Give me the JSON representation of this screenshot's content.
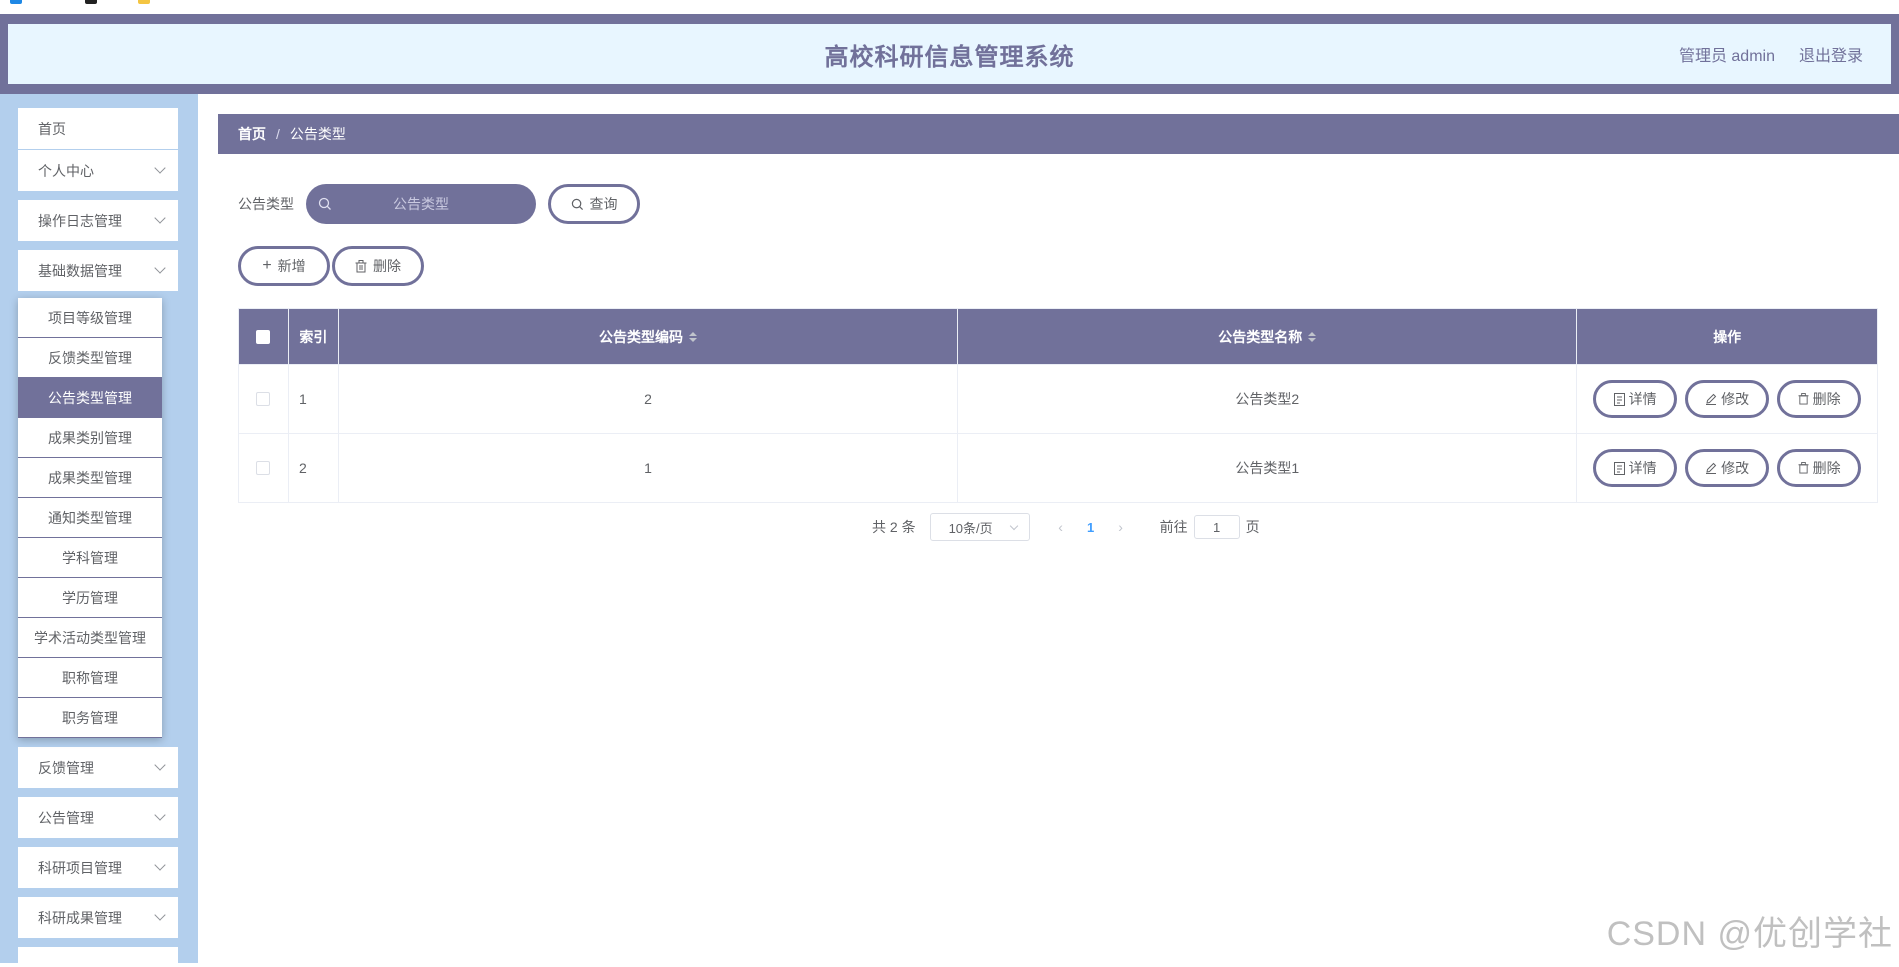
{
  "header": {
    "title": "高校科研信息管理系统",
    "user": "管理员 admin",
    "logout": "退出登录"
  },
  "sidebar": {
    "items": [
      {
        "label": "首页",
        "has_arrow": false
      },
      {
        "label": "个人中心",
        "has_arrow": true
      },
      {
        "label": "操作日志管理",
        "has_arrow": true
      },
      {
        "label": "基础数据管理",
        "has_arrow": true
      },
      {
        "label": "反馈管理",
        "has_arrow": true
      },
      {
        "label": "公告管理",
        "has_arrow": true
      },
      {
        "label": "科研项目管理",
        "has_arrow": true
      },
      {
        "label": "科研成果管理",
        "has_arrow": true
      }
    ],
    "submenu": [
      "项目等级管理",
      "反馈类型管理",
      "公告类型管理",
      "成果类别管理",
      "成果类型管理",
      "通知类型管理",
      "学科管理",
      "学历管理",
      "学术活动类型管理",
      "职称管理",
      "职务管理"
    ],
    "active_submenu": "公告类型管理"
  },
  "breadcrumb": {
    "home": "首页",
    "separator": "/",
    "current": "公告类型"
  },
  "search": {
    "label": "公告类型",
    "placeholder": "公告类型",
    "button": "查询"
  },
  "actions": {
    "add": "新增",
    "delete": "删除"
  },
  "table": {
    "headers": {
      "index": "索引",
      "code": "公告类型编码",
      "name": "公告类型名称",
      "ops": "操作"
    },
    "rows": [
      {
        "index": "1",
        "code": "2",
        "name": "公告类型2"
      },
      {
        "index": "2",
        "code": "1",
        "name": "公告类型1"
      }
    ],
    "row_buttons": {
      "detail": "详情",
      "edit": "修改",
      "delete": "删除"
    }
  },
  "pagination": {
    "total": "共 2 条",
    "page_size": "10条/页",
    "current_page": "1",
    "goto_label": "前往",
    "goto_value": "1",
    "page_suffix": "页"
  },
  "watermark": "CSDN @优创学社",
  "colors": {
    "primary": "#71719a",
    "header_bg": "#e8f6ff",
    "sidebar_bg": "#b3cfed",
    "page_active": "#409eff"
  }
}
